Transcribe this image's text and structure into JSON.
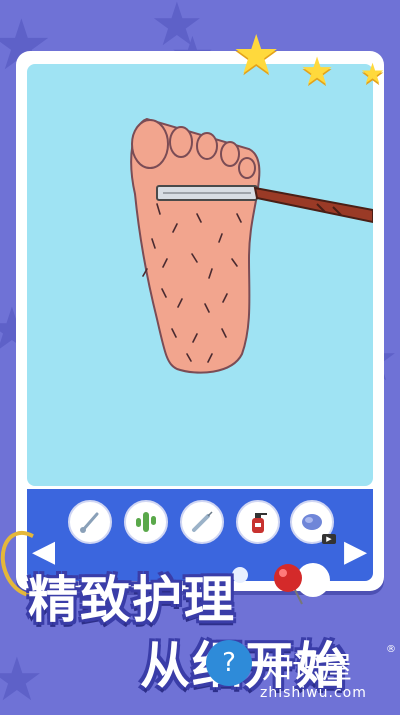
{
  "slogan": {
    "line1": "精致护理",
    "line2": "从细开始"
  },
  "watermark": {
    "name": "知识屋",
    "reg": "®",
    "url": "zhishiwu.com",
    "icon": "question-monitor-icon"
  },
  "tools": [
    {
      "name": "thermometer",
      "icon": "thermometer-icon"
    },
    {
      "name": "cactus",
      "icon": "cactus-icon"
    },
    {
      "name": "syringe",
      "icon": "syringe-icon"
    },
    {
      "name": "spray",
      "icon": "spray-bottle-icon"
    },
    {
      "name": "pad",
      "icon": "pad-icon",
      "badge": "video-icon"
    }
  ],
  "colors": {
    "background": "#6f72d6",
    "canvas": "#9fe3f3",
    "toolbar": "#3b66de",
    "star": "#ffd93c"
  }
}
